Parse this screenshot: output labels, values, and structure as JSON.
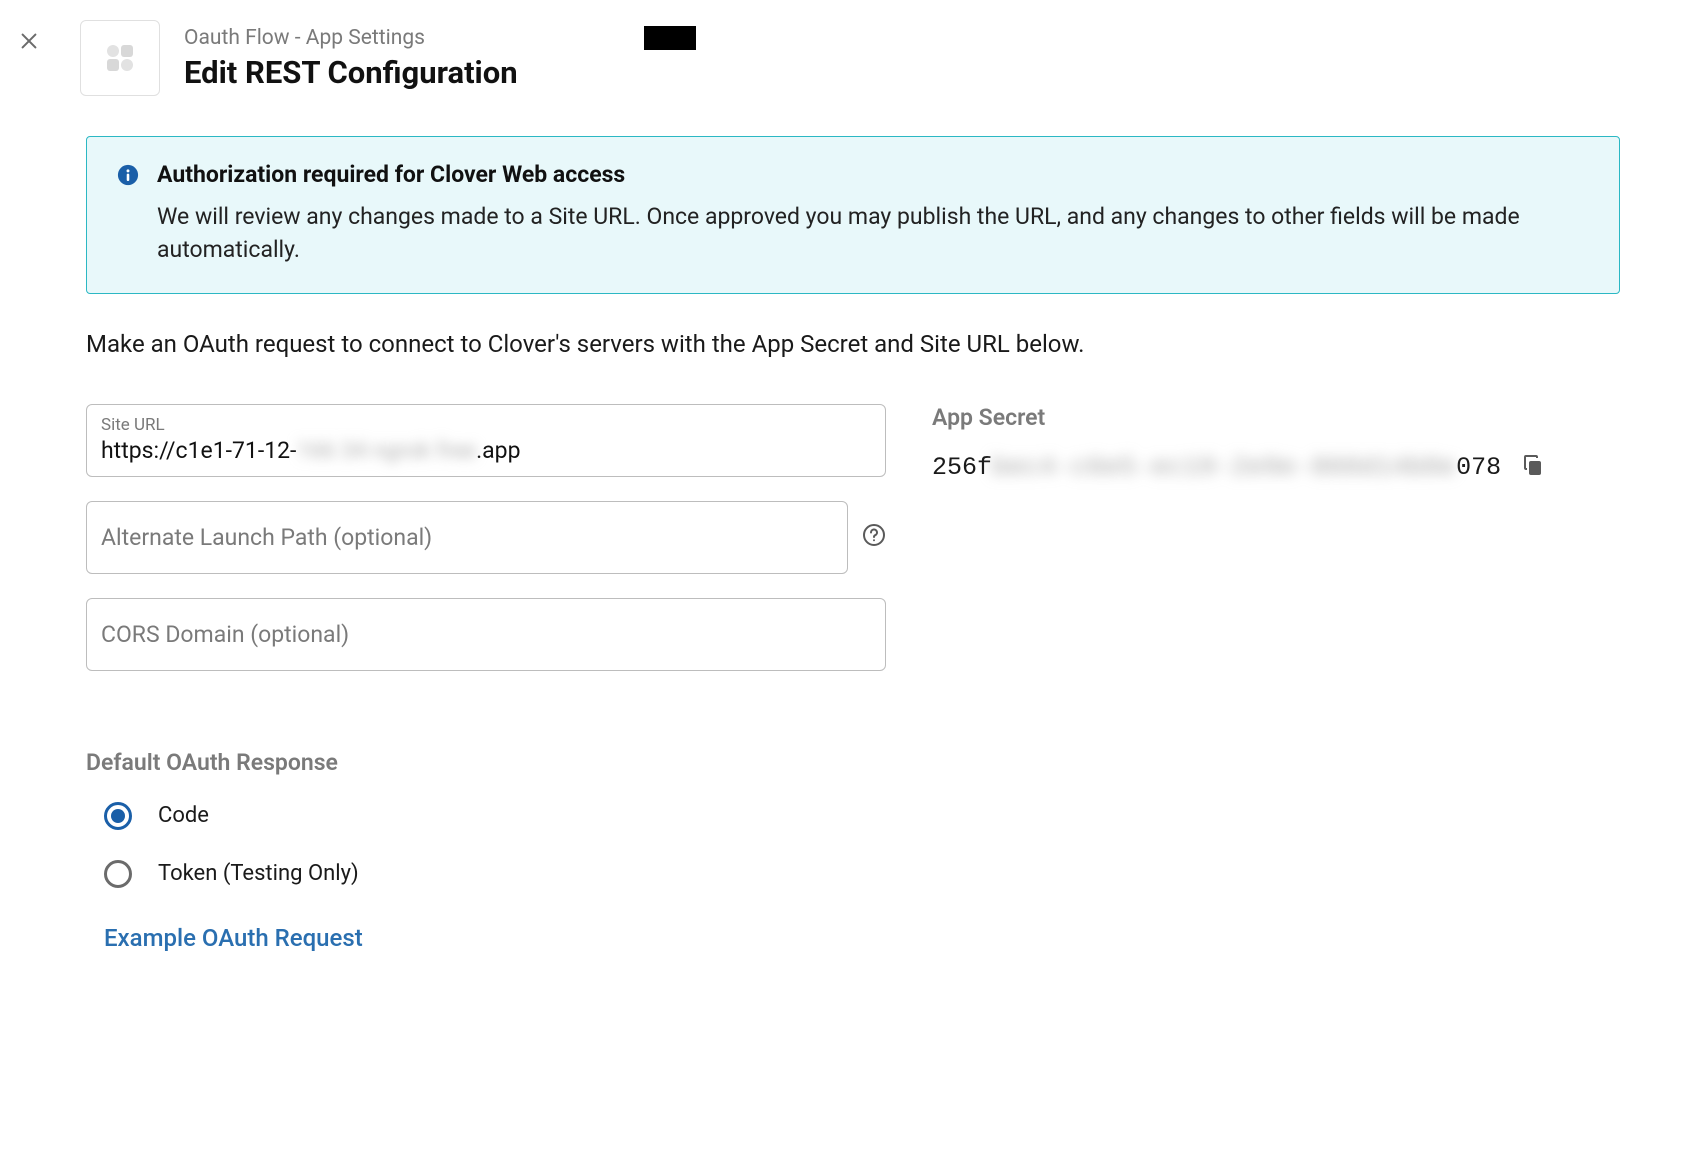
{
  "header": {
    "breadcrumb": "Oauth Flow - App Settings",
    "title": "Edit REST Configuration"
  },
  "alert": {
    "title": "Authorization required for Clover Web access",
    "body": "We will review any changes made to a Site URL. Once approved you may publish the URL, and any changes to other fields will be made automatically."
  },
  "description": "Make an OAuth request to connect to Clover's servers with the App Secret and Site URL below.",
  "form": {
    "site_url": {
      "label": "Site URL",
      "prefix": "https://c1e1-71-12-",
      "masked": "166 34 ngrok free",
      "suffix": ".app"
    },
    "alt_launch": {
      "placeholder": "Alternate Launch Path (optional)",
      "value": ""
    },
    "cors": {
      "placeholder": "CORS Domain (optional)",
      "value": ""
    },
    "app_secret": {
      "label": "App Secret",
      "prefix": "256f",
      "masked": "bec4-c6e5-ec19-2e9e-860d14b0e",
      "suffix": "078"
    }
  },
  "oauth_response": {
    "label": "Default OAuth Response",
    "options": [
      {
        "label": "Code",
        "selected": true
      },
      {
        "label": "Token (Testing Only)",
        "selected": false
      }
    ]
  },
  "example_link": "Example OAuth Request"
}
